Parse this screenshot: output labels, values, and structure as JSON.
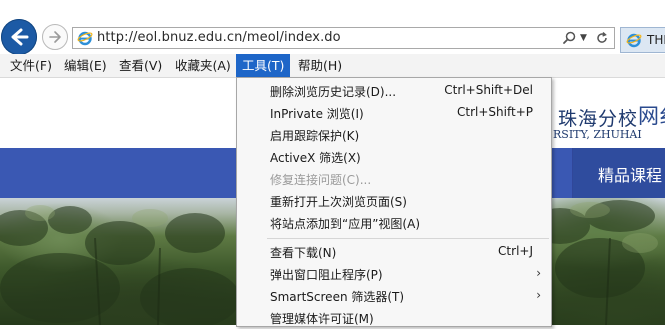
{
  "browser": {
    "address": "http://eol.bnuz.edu.cn/meol/index.do",
    "tab_title": "THE"
  },
  "menubar": {
    "items": [
      {
        "label": "文件(F)"
      },
      {
        "label": "编辑(E)"
      },
      {
        "label": "查看(V)"
      },
      {
        "label": "收藏夹(A)"
      },
      {
        "label": "工具(T)",
        "active": true
      },
      {
        "label": "帮助(H)"
      }
    ]
  },
  "page": {
    "school_name": "珠海分校",
    "school_name_en": "RSITY, ZHUHAI",
    "site_name": "网纟",
    "nav_item": "精品课程"
  },
  "tools_menu": {
    "items": [
      {
        "label": "删除浏览历史记录(D)...",
        "shortcut": "Ctrl+Shift+Del"
      },
      {
        "label": "InPrivate 浏览(I)",
        "shortcut": "Ctrl+Shift+P"
      },
      {
        "label": "启用跟踪保护(K)",
        "shortcut": ""
      },
      {
        "label": "ActiveX 筛选(X)",
        "shortcut": ""
      },
      {
        "label": "修复连接问题(C)...",
        "shortcut": "",
        "disabled": true
      },
      {
        "label": "重新打开上次浏览页面(S)",
        "shortcut": ""
      },
      {
        "label": "将站点添加到“应用”视图(A)",
        "shortcut": ""
      },
      {
        "label": "查看下载(N)",
        "shortcut": "Ctrl+J"
      },
      {
        "label": "弹出窗口阻止程序(P)",
        "shortcut": "",
        "submenu": true
      },
      {
        "label": "SmartScreen 筛选器(T)",
        "shortcut": "",
        "submenu": true
      },
      {
        "label": "管理媒体许可证(M)",
        "shortcut": ""
      }
    ]
  },
  "colors": {
    "menu_active_bg": "#1e66c8",
    "nav_band": "#3a58b3",
    "back_button": "#1c5aa5"
  }
}
